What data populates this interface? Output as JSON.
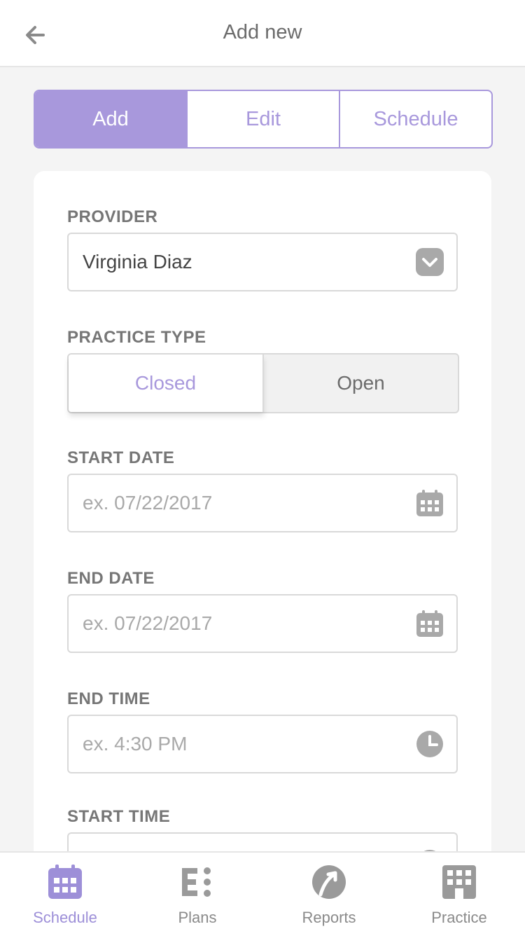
{
  "header": {
    "title": "Add new",
    "back_icon": "arrow-left-icon"
  },
  "segments": [
    {
      "label": "Add",
      "active": true
    },
    {
      "label": "Edit",
      "active": false
    },
    {
      "label": "Schedule",
      "active": false
    }
  ],
  "form": {
    "provider": {
      "label": "PROVIDER",
      "value": "Virginia Diaz",
      "icon": "chevron-down-icon"
    },
    "practice_type": {
      "label": "PRACTICE TYPE",
      "options": [
        "Closed",
        "Open"
      ],
      "selected": "Closed"
    },
    "start_date": {
      "label": "START DATE",
      "placeholder": "ex. 07/22/2017",
      "icon": "calendar-icon"
    },
    "end_date": {
      "label": "END DATE",
      "placeholder": "ex. 07/22/2017",
      "icon": "calendar-icon"
    },
    "end_time": {
      "label": "END TIME",
      "placeholder": "ex. 4:30 PM",
      "icon": "clock-icon"
    },
    "start_time": {
      "label": "START TIME",
      "icon": "clock-icon"
    }
  },
  "tabbar": [
    {
      "label": "Schedule",
      "icon": "calendar-icon",
      "active": true
    },
    {
      "label": "Plans",
      "icon": "plans-icon",
      "active": false
    },
    {
      "label": "Reports",
      "icon": "reports-icon",
      "active": false
    },
    {
      "label": "Practice",
      "icon": "building-icon",
      "active": false
    }
  ],
  "colors": {
    "accent": "#a898dc",
    "label_gray": "#767676",
    "border": "#d9d9d9",
    "background": "#f4f4f4"
  }
}
